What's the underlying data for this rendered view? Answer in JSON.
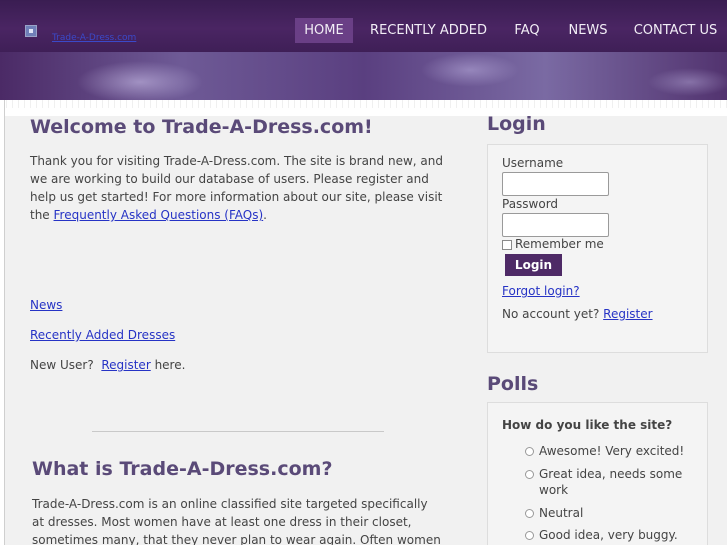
{
  "header": {
    "logo_text": "Trade-A-Dress.com",
    "nav": [
      {
        "label": "HOME",
        "active": true
      },
      {
        "label": "RECENTLY ADDED",
        "active": false
      },
      {
        "label": "FAQ",
        "active": false
      },
      {
        "label": "NEWS",
        "active": false
      },
      {
        "label": "CONTACT US",
        "active": false
      }
    ]
  },
  "main": {
    "welcome_title": "Welcome to Trade-A-Dress.com!",
    "intro_text": "Thank you for visiting Trade-A-Dress.com.  The site is brand new, and we are working to build our database of users.  Please register and help us get started!  For more information about our site, please visit the ",
    "faq_link": "Frequently Asked Questions (FAQs)",
    "intro_end": ".",
    "news_link": "News",
    "recent_link": "Recently Added Dresses",
    "new_user_prefix": "New User?  ",
    "register_link": "Register",
    "new_user_suffix": " here.",
    "what_title": "What is Trade-A-Dress.com?",
    "what_text": "Trade-A-Dress.com is an online classified site targeted specifically at dresses.  Most women have at least one dress in their closet, sometimes many, that they never plan to wear again.  Often women will trade these"
  },
  "login": {
    "title": "Login",
    "username_label": "Username",
    "password_label": "Password",
    "remember_label": "Remember me",
    "button_label": "Login",
    "forgot_link": "Forgot login?",
    "no_account_text": "No account yet? ",
    "register_link": "Register"
  },
  "polls": {
    "title": "Polls",
    "question": "How do you like the site?",
    "options": [
      "Awesome! Very excited!",
      "Great idea, needs some work",
      "Neutral",
      "Good idea, very buggy."
    ]
  },
  "colors": {
    "header_bg": "#4a2563",
    "nav_active": "#6a3f86",
    "heading": "#5a4a78",
    "link": "#2633c5",
    "button_bg": "#4e2a66"
  }
}
